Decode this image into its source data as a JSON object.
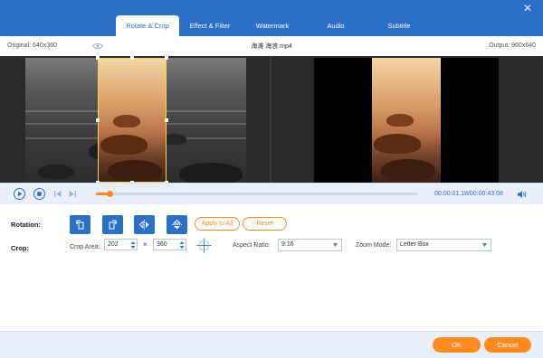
{
  "window": {
    "close_glyph": "✕"
  },
  "tabs": [
    {
      "label": "Rotate & Crop",
      "active": true
    },
    {
      "label": "Effect & Filter",
      "active": false
    },
    {
      "label": "Watermark",
      "active": false
    },
    {
      "label": "Audio",
      "active": false
    },
    {
      "label": "Subtitle",
      "active": false
    }
  ],
  "info": {
    "original": "Original: 640x360",
    "filename": "海滩 海浪.mp4",
    "output": "Output: 960x640"
  },
  "player": {
    "time": "00:00:01.18/00:00:43.08",
    "progress_fraction": 0.045
  },
  "rotation": {
    "label": "Rotation:",
    "apply_all": "Apply to All",
    "reset": "Reset"
  },
  "crop": {
    "label": "Crop:",
    "area_label": "Crop Area:",
    "width": "202",
    "times": "×",
    "height": "360",
    "aspect_label": "Aspect Ratio:",
    "aspect_value": "9:16",
    "zoom_label": "Zoom Mode:",
    "zoom_value": "Letter Box"
  },
  "footer": {
    "ok": "OK",
    "cancel": "Cancel"
  },
  "colors": {
    "accent": "#2b6fc9",
    "orange": "#ff8a1e"
  }
}
